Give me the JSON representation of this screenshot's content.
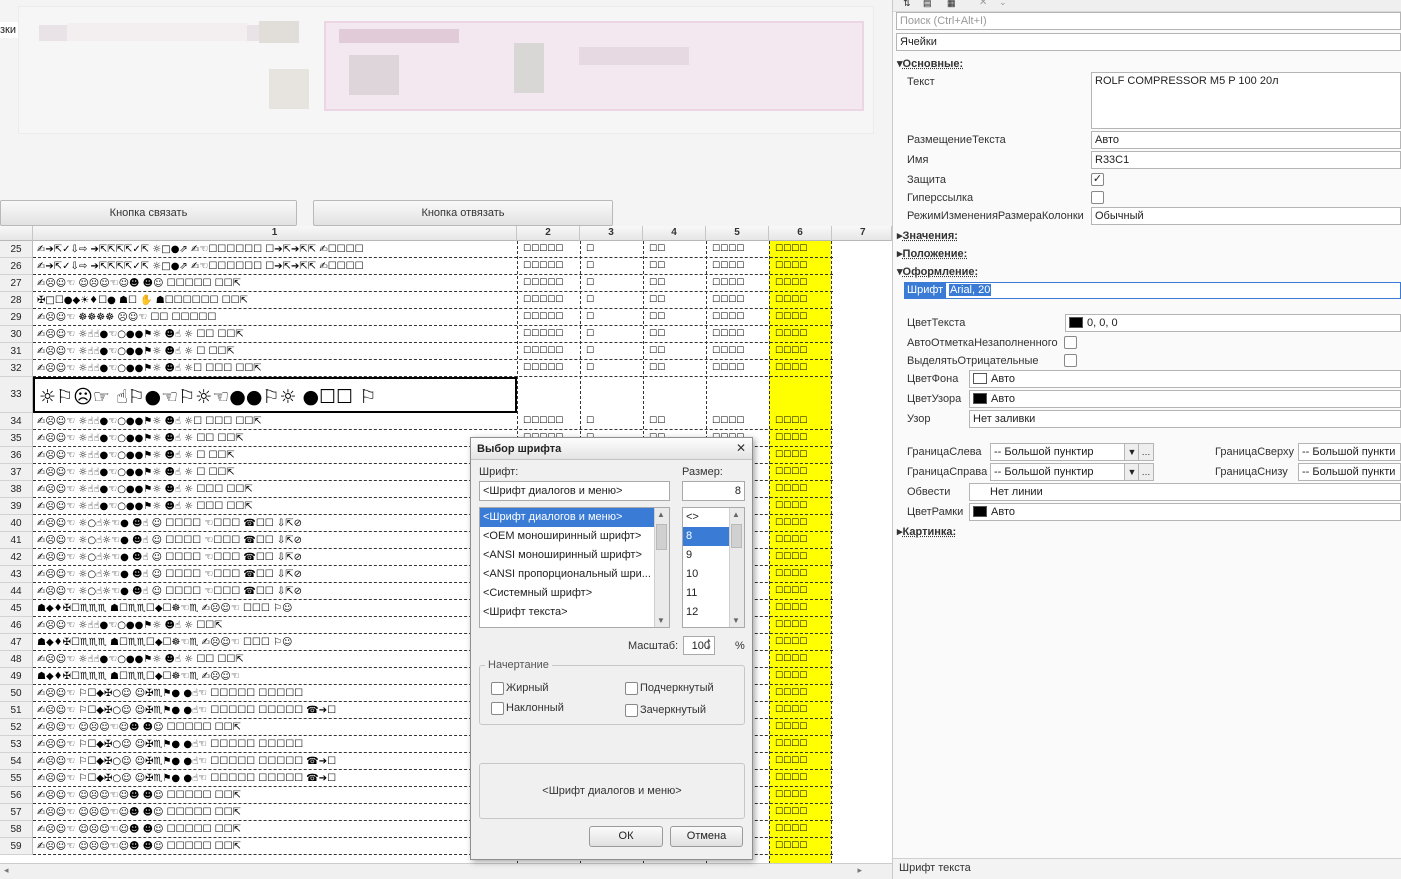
{
  "left": {
    "edge_label": "зки",
    "buttons": {
      "link": "Кнопка связать",
      "unlink": "Кнопка отвязать"
    },
    "columns": [
      "1",
      "2",
      "3",
      "4",
      "5",
      "6",
      "7"
    ],
    "rows": [
      {
        "num": "25",
        "glyphs": "✍➔⇱✓⇩⇨  ➔⇱⇱⇱⇱✓⇱  ☼□●⇗  ✍☜☐☐☐☐☐☐  ☐➔⇱➔⇱⇱  ✍☐☐☐☐"
      },
      {
        "num": "26",
        "glyphs": "✍➔⇱✓⇩⇨  ➔⇱⇱⇱⇱✓⇱  ☼□●⇗  ✍☜☐☐☐☐☐☐  ☐➔⇱➔⇱⇱  ✍☐☐☐☐"
      },
      {
        "num": "27",
        "glyphs": "✍☹☺☜  ☺☹☺☜☺☻  ☻☺  ☐☐☐☐☐  ☐☐⇱"
      },
      {
        "num": "28",
        "glyphs": "✠□☐●◆☀♦☐●  ☗☐  ✋  ☗☐☐☐☐☐☐  ☐☐⇱"
      },
      {
        "num": "29",
        "glyphs": "✍☹☺☜  ☸☸☸☸  ☹☺☜  ☐☐  ☐☐☐☐☐"
      },
      {
        "num": "30",
        "glyphs": "✍☹☺☜  ☼☝☝●☜○●●⚑☼  ☻☝  ☼  ☐☐  ☐☐⇱"
      },
      {
        "num": "31",
        "glyphs": "✍☹☺☜  ☼☝☝●☜○●●⚑☼  ☻☝  ☼  ☐  ☐☐⇱"
      },
      {
        "num": "32",
        "glyphs": "✍☹☺☜  ☼☝☝●☜○●●⚑☼  ☻☝  ☼☐  ☐☐☐  ☐☐⇱"
      },
      {
        "num": "33",
        "glyphs": "☼⚐☹☞   ☝⚐●☜⚐☼☜●●⚐☼   ●☐☐  ⚐"
      },
      {
        "num": "34",
        "glyphs": "✍☹☺☜  ☼☝☝●☜○●●⚑☼  ☻☝  ☼☐  ☐☐☐  ☐☐⇱"
      },
      {
        "num": "35",
        "glyphs": "✍☹☺☜  ☼☝☝●☜○●●⚑☼  ☻☝  ☼  ☐☐  ☐☐⇱"
      },
      {
        "num": "36",
        "glyphs": "✍☹☺☜  ☼☝☝●☜○●●⚑☼  ☻☝  ☼  ☐  ☐☐⇱"
      },
      {
        "num": "37",
        "glyphs": "✍☹☺☜  ☼☝☝●☜○●●⚑☼  ☻☝  ☼  ☐  ☐☐⇱"
      },
      {
        "num": "38",
        "glyphs": "✍☹☺☜  ☼☝☝●☜○●●⚑☼  ☻☝  ☼  ☐☐☐  ☐☐⇱"
      },
      {
        "num": "39",
        "glyphs": "✍☹☺☜  ☼☝☝●☜○●●⚑☼  ☻☝  ☼  ☐☐☐  ☐☐⇱"
      },
      {
        "num": "40",
        "glyphs": "✍☹☺☜  ☼○☝☼☜●  ☻☝  ☺  ☐☐☐☐  ☜☐☐☐  ☎☐☐  ⇩⇱⊘"
      },
      {
        "num": "41",
        "glyphs": "✍☹☺☜  ☼○☝☼☜●  ☻☝  ☺  ☐☐☐☐  ☜☐☐☐  ☎☐☐  ⇩⇱⊘"
      },
      {
        "num": "42",
        "glyphs": "✍☹☺☜  ☼○☝☼☜●  ☻☝  ☺  ☐☐☐☐  ☜☐☐☐  ☎☐☐  ⇩⇱⊘"
      },
      {
        "num": "43",
        "glyphs": "✍☹☺☜  ☼○☝☼☜●  ☻☝  ☺  ☐☐☐☐  ☜☐☐☐  ☎☐☐  ⇩⇱⊘"
      },
      {
        "num": "44",
        "glyphs": "✍☹☺☜  ☼○☝☼☜●  ☻☝  ☺  ☐☐☐☐  ☜☐☐☐  ☎☐☐  ⇩⇱⊘"
      },
      {
        "num": "45",
        "glyphs": "☗◆♦✠☐♏♏♏  ☗☐♏♏☐◆☐☸☜♏  ✍☹☺☜  ☐☐☐  ⚐☺"
      },
      {
        "num": "46",
        "glyphs": "✍☹☺☜  ☼☝☝●☜○●●⚑☼  ☻☝  ☼  ☐☐⇱"
      },
      {
        "num": "47",
        "glyphs": "☗◆♦✠☐♏♏♏  ☗☐♏♏☐◆☐☸☜♏  ✍☹☺☜  ☐☐☐  ⚐☺"
      },
      {
        "num": "48",
        "glyphs": "✍☹☺☜  ☼☝☝●☜○●●⚑☼  ☻☝  ☼  ☐☐  ☐☐⇱"
      },
      {
        "num": "49",
        "glyphs": "☗◆♦✠☐♏♏♏  ☗☐♏♏☐◆☐☸☜♏  ✍☹☺☜"
      },
      {
        "num": "50",
        "glyphs": "✍☹☺☜  ⚐☐◆✠○☺  ☺✠♏⚑●  ●☝☜  ☐☐☐☐☐  ☐☐☐☐☐"
      },
      {
        "num": "51",
        "glyphs": "✍☹☺☜  ⚐☐◆✠○☺  ☺✠♏⚑●  ●☝☜  ☐☐☐☐☐  ☐☐☐☐☐  ☎➔☐"
      },
      {
        "num": "52",
        "glyphs": "✍☹☺☜  ☺☹☺☜☺☻  ☻☺  ☐☐☐☐☐  ☐☐⇱"
      },
      {
        "num": "53",
        "glyphs": "✍☹☺☜  ⚐☐◆✠○☺  ☺✠♏⚑●  ●☝☜  ☐☐☐☐☐  ☐☐☐☐☐"
      },
      {
        "num": "54",
        "glyphs": "✍☹☺☜  ⚐☐◆✠○☺  ☺✠♏⚑●  ●☝☜  ☐☐☐☐☐  ☐☐☐☐☐  ☎➔☐"
      },
      {
        "num": "55",
        "glyphs": "✍☹☺☜  ⚐☐◆✠○☺  ☺✠♏⚑●  ●☝☜  ☐☐☐☐☐  ☐☐☐☐☐  ☎➔☐"
      },
      {
        "num": "56",
        "glyphs": "✍☹☺☜  ☺☹☺☜☺☻  ☻☺  ☐☐☐☐☐  ☐☐⇱"
      },
      {
        "num": "57",
        "glyphs": "✍☹☺☜  ☺☹☺☜☺☻  ☻☺  ☐☐☐☐☐  ☐☐⇱"
      },
      {
        "num": "58",
        "glyphs": "✍☹☺☜  ☺☹☺☜☺☻  ☻☺  ☐☐☐☐☐  ☐☐⇱"
      },
      {
        "num": "59",
        "glyphs": "✍☹☺☜  ☺☹☺☜☺☻  ☻☺  ☐☐☐☐☐  ☐☐⇱"
      }
    ],
    "small_col_glyphs": {
      "c2": "☐☐☐☐☐",
      "c3": "☐",
      "c4": "☐☐",
      "c5": "☐☐☐☐",
      "c6": "☐☐☐☐"
    }
  },
  "right": {
    "toolbar_icons": [
      "sort-icon",
      "properties-icon",
      "list-icon",
      "close-icon",
      "dropdown-icon"
    ],
    "search_placeholder": "Поиск (Ctrl+Alt+I)",
    "object_name": "Ячейки",
    "sections": {
      "basic": "Основные:",
      "values": "Значения:",
      "position": "Положение:",
      "appearance": "Оформление:",
      "picture": "Картинка:"
    },
    "props": {
      "text_label": "Текст",
      "text_value": "ROLF COMPRESSOR M5 P 100  20л",
      "placement_label": "РазмещениеТекста",
      "placement_value": "Авто",
      "name_label": "Имя",
      "name_value": "R33C1",
      "protect_label": "Защита",
      "protect_checked": "✓",
      "hyperlink_label": "Гиперссылка",
      "resize_label": "РежимИзмененияРазмераКолонки",
      "resize_value": "Обычный",
      "font_label": "Шрифт",
      "font_value": "Arial, 20",
      "textcolor_label": "ЦветТекста",
      "textcolor_value": "0, 0, 0",
      "automark_label": "АвтоОтметкаНезаполненного",
      "negative_label": "ВыделятьОтрицательные",
      "bg_label": "ЦветФона",
      "bg_value": "Авто",
      "pattern_color_label": "ЦветУзора",
      "pattern_color_value": "Авто",
      "pattern_label": "Узор",
      "pattern_value": "Нет заливки",
      "border_left_label": "ГраницаСлева",
      "border_left_value": "-- Большой пунктир",
      "border_top_label": "ГраницаСверху",
      "border_top_value": "-- Большой пункти",
      "border_right_label": "ГраницаСправа",
      "border_right_value": "-- Большой пунктир",
      "border_bottom_label": "ГраницаСнизу",
      "border_bottom_value": "-- Большой пункти",
      "surround_label": "Обвести",
      "surround_value": "Нет линии",
      "frame_color_label": "ЦветРамки",
      "frame_color_value": "Авто"
    },
    "status_text": "Шрифт текста",
    "colors": {
      "swatch_black": "#000000",
      "swatch_white": "#ffffff",
      "selection": "#3a7bd5",
      "highlight": "#ffff00"
    }
  },
  "dialog": {
    "title": "Выбор шрифта",
    "font_label": "Шрифт:",
    "size_label": "Размер:",
    "font_value": "<Шрифт диалогов и меню>",
    "size_value": "8",
    "fonts": [
      "<Шрифт диалогов и меню>",
      "<OEM моноширинный шрифт>",
      "<ANSI моноширинный шрифт>",
      "<ANSI пропорциональный шри...",
      "<Системный шрифт>",
      "<Шрифт текста>"
    ],
    "sizes": [
      "<>",
      "8",
      "9",
      "10",
      "11",
      "12"
    ],
    "scale_label": "Масштаб:",
    "scale_value": "100",
    "percent": "%",
    "style_group": "Начертание",
    "bold": "Жирный",
    "italic": "Наклонный",
    "underline": "Подчеркнутый",
    "strike": "Зачеркнутый",
    "preview": "<Шрифт диалогов и меню>",
    "ok": "ОК",
    "cancel": "Отмена",
    "close_glyph": "✕"
  }
}
